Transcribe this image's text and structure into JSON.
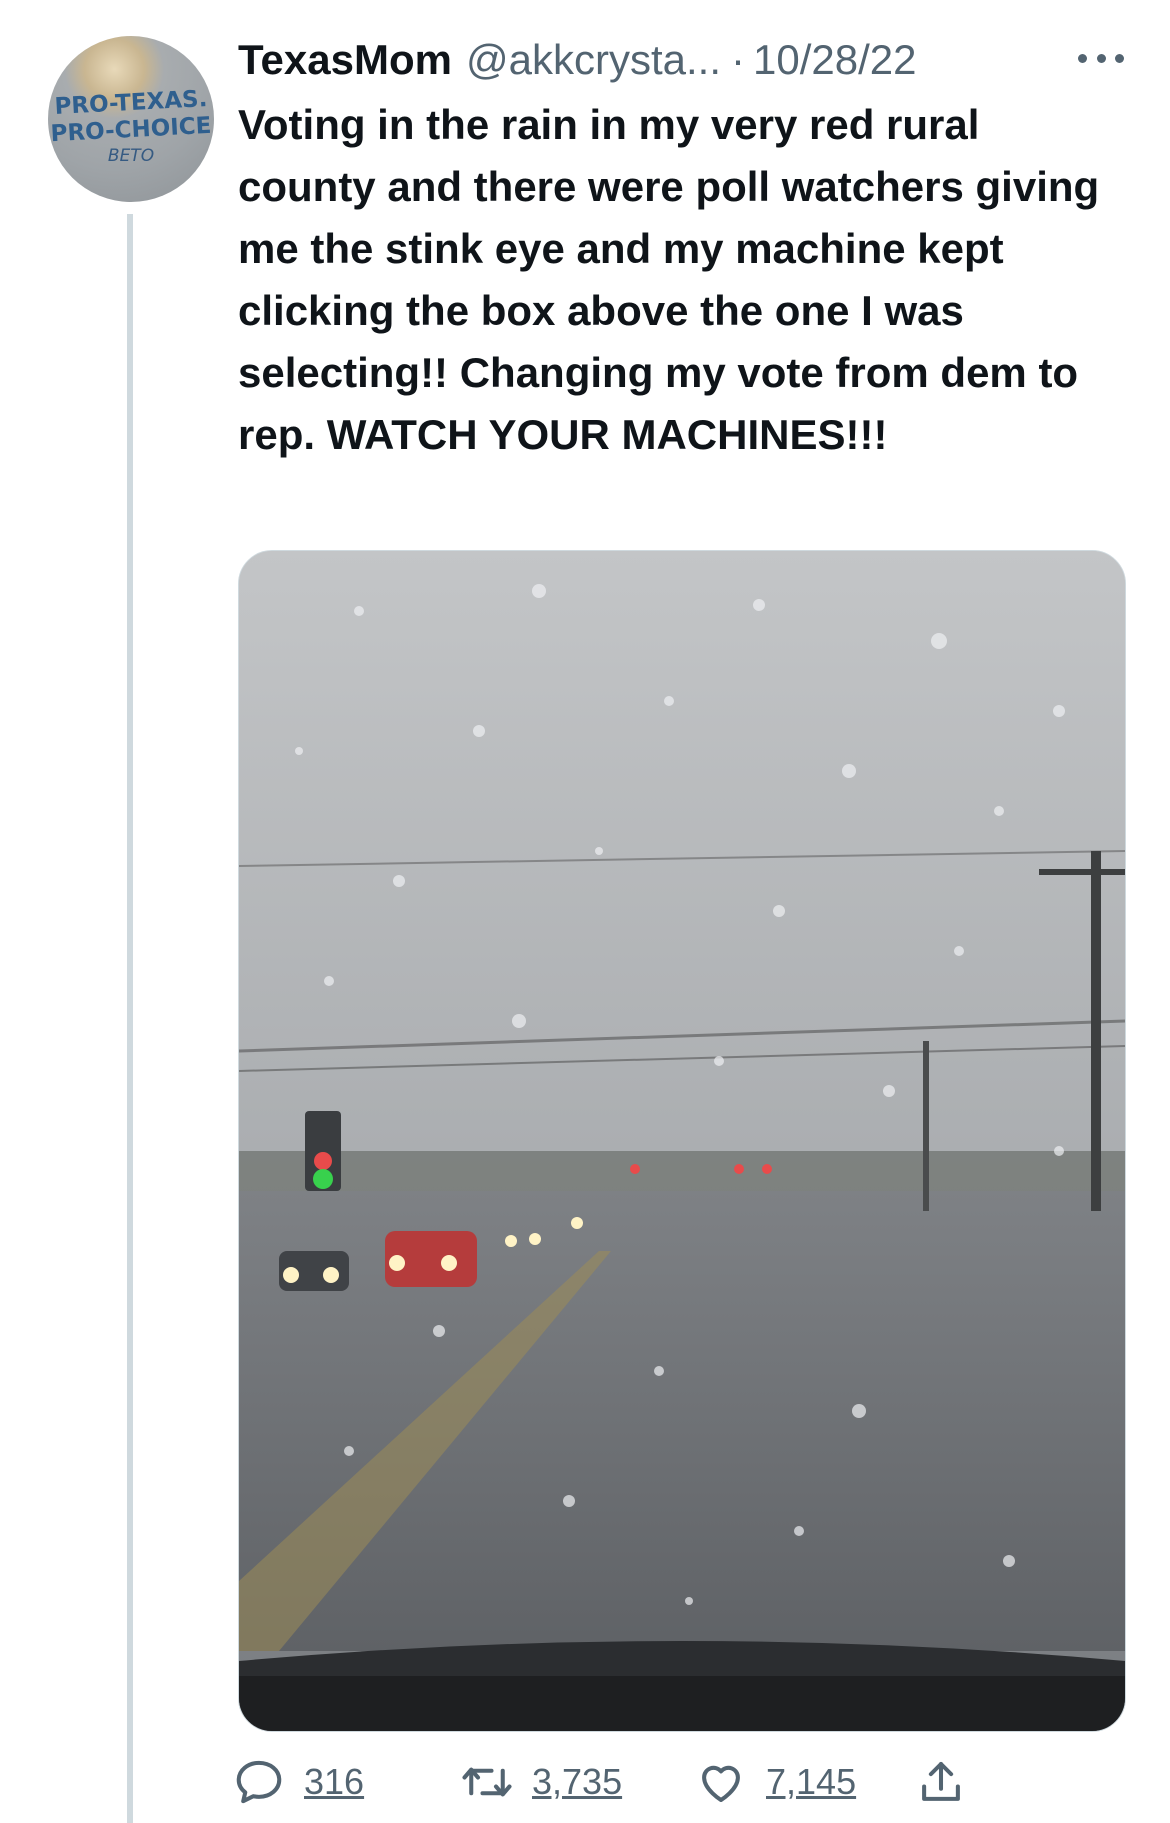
{
  "tweet": {
    "author_name": "TexasMom",
    "handle": "@akkcrysta...",
    "separator": "·",
    "date": "10/28/22",
    "text": "Voting in the rain in my very red rural county and there were poll watchers giving me the stink eye and my machine kept clicking the box above the one I was selecting!! Changing my vote from dem to rep. WATCH YOUR MACHINES!!!"
  },
  "avatar": {
    "shirt_line1": "PRO-TEXAS.",
    "shirt_line2": "PRO-CHOICE",
    "shirt_line3": "BETO"
  },
  "actions": {
    "replies": "316",
    "retweets": "3,735",
    "likes": "7,145"
  },
  "icons": [
    "reply-icon",
    "retweet-icon",
    "like-icon",
    "share-icon",
    "more-icon"
  ],
  "colors": {
    "text_primary": "#0f1419",
    "text_secondary": "#536471",
    "thread_line": "#cfd9de"
  }
}
